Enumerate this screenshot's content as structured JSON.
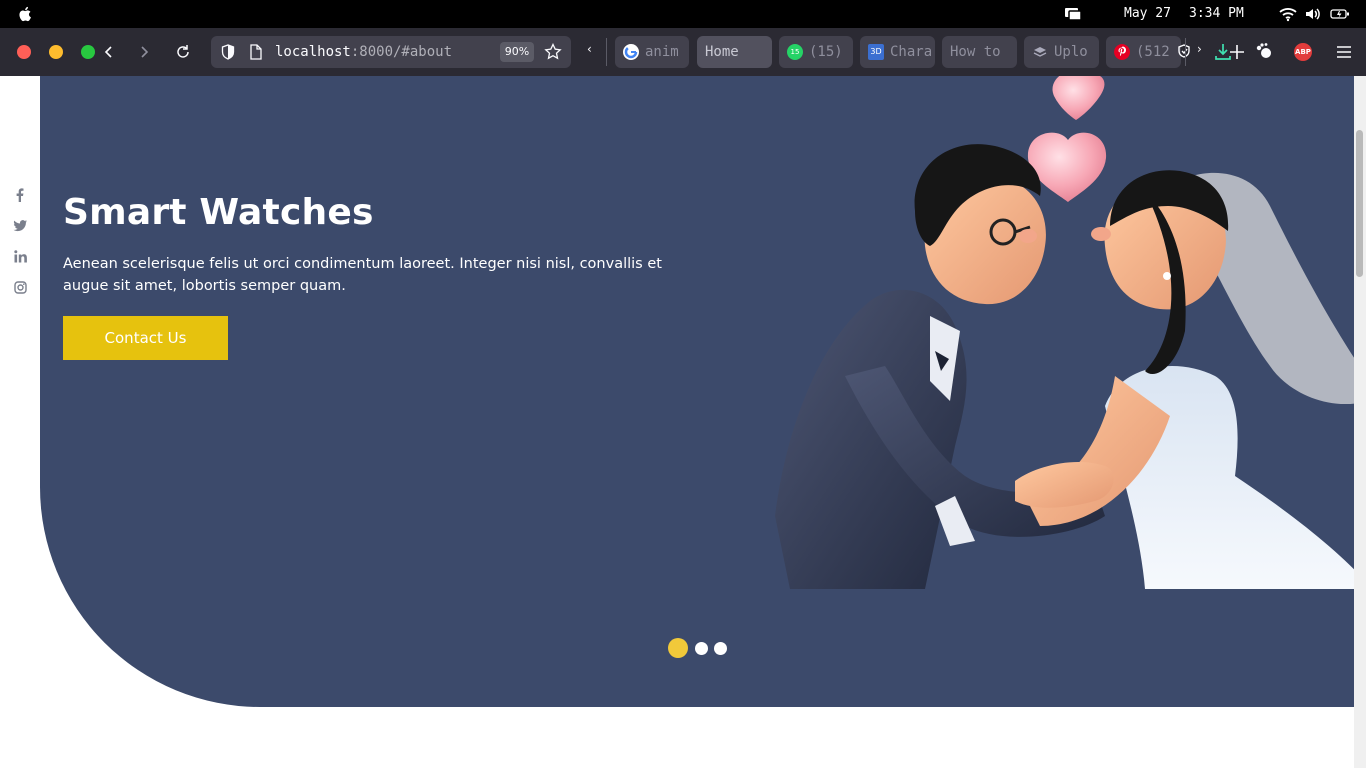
{
  "menubar": {
    "date": "May 27",
    "time": "3:34 PM"
  },
  "browser": {
    "url_host": "localhost",
    "url_path": ":8000/#about",
    "zoom": "90%",
    "tab_scroll_left": "‹",
    "tab_scroll_right": "›",
    "tabs": [
      {
        "label": "anim",
        "icon": "google-icon",
        "active": false
      },
      {
        "label": "Home",
        "icon": "",
        "active": true
      },
      {
        "label": "(15)",
        "icon": "whatsapp-icon",
        "active": false
      },
      {
        "label": "Chara",
        "icon": "3d-icon",
        "active": false
      },
      {
        "label": "How to",
        "icon": "",
        "active": false
      },
      {
        "label": "Uplo",
        "icon": "layers-icon",
        "active": false
      },
      {
        "label": "(512",
        "icon": "pinterest-icon",
        "active": false
      }
    ],
    "whatsapp_badge": "15",
    "badge_3d": "3D",
    "abp_label": "ABP"
  },
  "page": {
    "hero": {
      "title": "Smart Watches",
      "description": "Aenean scelerisque felis ut orci condimentum laoreet. Integer nisi nisl, convallis et augue sit amet, lobortis semper quam.",
      "cta_label": "Contact Us"
    },
    "carousel": {
      "slide_count": 3,
      "active_index": 0
    },
    "social": [
      "facebook-icon",
      "twitter-icon",
      "linkedin-icon",
      "instagram-icon"
    ]
  },
  "colors": {
    "hero_bg": "#3c4a6b",
    "accent": "#e6c20e",
    "active_dot": "#f1c93a"
  }
}
